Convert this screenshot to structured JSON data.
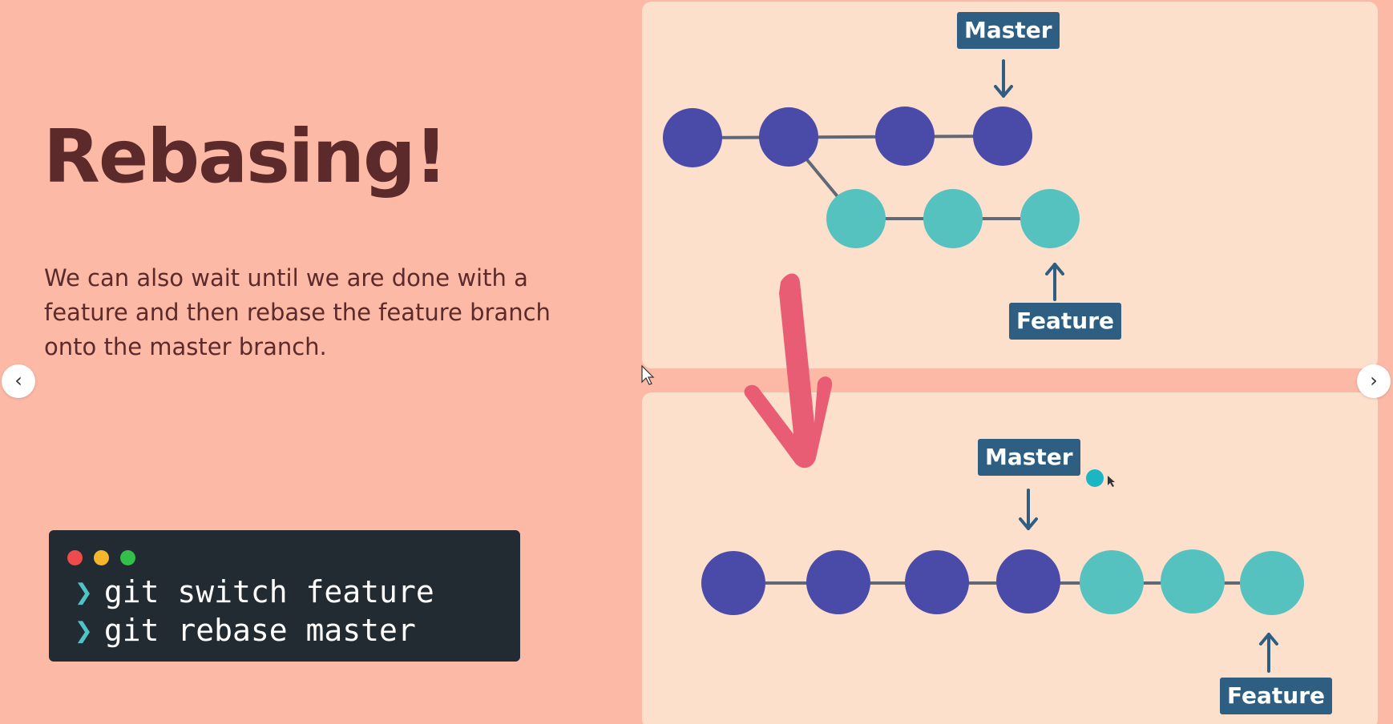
{
  "slide": {
    "title": "Rebasing!",
    "description": "We can also wait until we are done with a feature and then rebase the feature branch onto the master branch."
  },
  "terminal": {
    "lines": [
      {
        "prompt": "❯",
        "command": "git switch feature"
      },
      {
        "prompt": "❯",
        "command": "git rebase master"
      }
    ]
  },
  "diagram_top": {
    "master_label": "Master",
    "feature_label": "Feature",
    "master_commits": 4,
    "feature_commits": 3
  },
  "diagram_bottom": {
    "master_label": "Master",
    "feature_label": "Feature",
    "master_commits": 4,
    "feature_commits": 3
  },
  "navigation": {
    "prev_label": "‹",
    "next_label": "›"
  },
  "colors": {
    "background": "#fbb9a6",
    "panel": "#fde0cc",
    "master_commit": "#4a4aa8",
    "feature_commit": "#56c2c0",
    "label_bg": "#2e5f82",
    "arrow": "#e95d74",
    "terminal_bg": "#222b31"
  }
}
